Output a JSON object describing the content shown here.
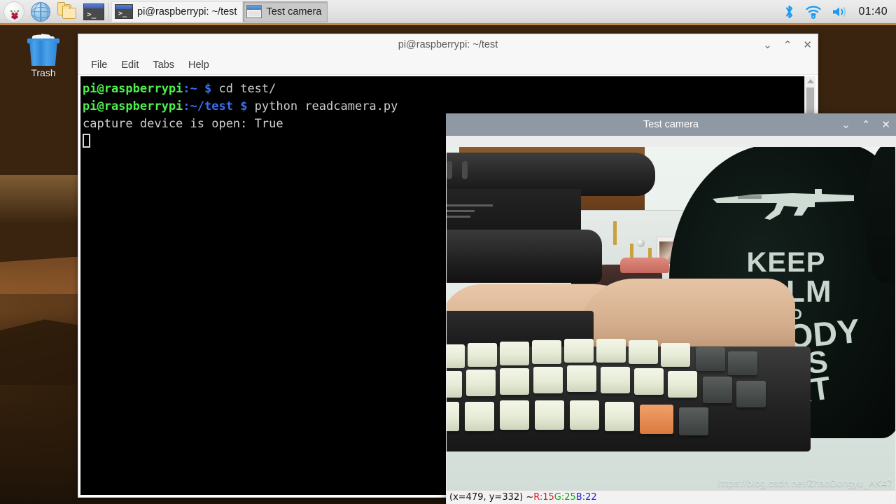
{
  "taskbar": {
    "launchers": [
      {
        "name": "raspberry-menu",
        "label": "Menu"
      },
      {
        "name": "web-browser",
        "label": "Web Browser"
      },
      {
        "name": "file-manager",
        "label": "File Manager"
      },
      {
        "name": "terminal",
        "label": "Terminal"
      }
    ],
    "windows": [
      {
        "label": "pi@raspberrypi: ~/test",
        "icon": "terminal-icon",
        "active": false
      },
      {
        "label": "Test camera",
        "icon": "window-icon",
        "active": true
      }
    ],
    "tray": [
      "bluetooth-icon",
      "wifi-icon",
      "volume-icon"
    ],
    "clock": "01:40"
  },
  "desktop": {
    "trash": {
      "label": "Trash",
      "icon": "trash-bin-icon"
    }
  },
  "terminal_window": {
    "title": "pi@raspberrypi: ~/test",
    "menu": [
      "File",
      "Edit",
      "Tabs",
      "Help"
    ],
    "controls": {
      "minimize": "⌄",
      "maximize": "⌃",
      "close": "✕"
    },
    "lines": [
      {
        "user": "pi@raspberrypi",
        "path": ":~",
        "sigil": " $ ",
        "command": "cd test/"
      },
      {
        "user": "pi@raspberrypi",
        "path": ":~/test",
        "sigil": " $ ",
        "command": "python readcamera.py"
      }
    ],
    "output": "capture device is open: True"
  },
  "camera_window": {
    "title": "Test camera",
    "controls": {
      "minimize": "⌄",
      "maximize": "⌃",
      "close": "✕"
    },
    "status": {
      "coords": "(x=479, y=332) ~ ",
      "r": "R:15",
      "g": " G:25",
      "b": " B:22"
    },
    "watermark": "https://blog.csdn.net/ZhaoDongyu_AK47",
    "scene": {
      "tshirt_text": [
        "KEEP",
        "CALM",
        "AND",
        "NOBODY",
        "GETS",
        "HURT"
      ],
      "tshirt_graphic": "ak47-rifle-icon"
    }
  },
  "colors": {
    "taskbar_bg": "#e2e2e2",
    "taskbar_accent": "#c08a46",
    "active_titlebar": "#8e99a4",
    "terminal_bg": "#000000",
    "prompt_user": "#4ef04e",
    "prompt_path": "#3b6ff0",
    "status_r": "#d81d1d",
    "status_g": "#15a015",
    "status_b": "#2323dd"
  }
}
